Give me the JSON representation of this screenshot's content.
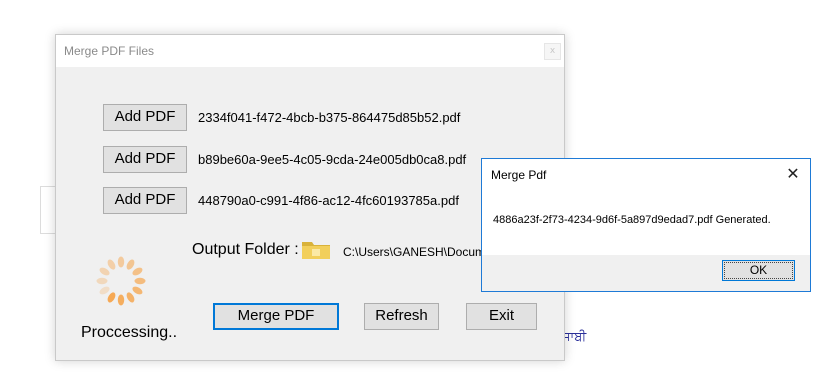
{
  "main_window": {
    "title": "Merge PDF Files",
    "close_glyph": "x",
    "rows": [
      {
        "button_label": "Add PDF",
        "file_name": "2334f041-f472-4bcb-b375-864475d85b52.pdf"
      },
      {
        "button_label": "Add PDF",
        "file_name": "b89be60a-9ee5-4c05-9cda-24e005db0ca8.pdf"
      },
      {
        "button_label": "Add PDF",
        "file_name": "448790a0-c991-4f86-ac12-4fc60193785a.pdf"
      }
    ],
    "output_folder_label": "Output Folder :",
    "output_folder_path": "C:\\Users\\GANESH\\Documents",
    "folder_icon": "folder-icon",
    "spinner_icon": "loading-spinner-icon",
    "status_text": "Proccessing..",
    "buttons": {
      "merge": "Merge PDF",
      "refresh": "Refresh",
      "exit": "Exit"
    }
  },
  "dialog": {
    "title": "Merge Pdf",
    "close_glyph": "✕",
    "message": "4886a23f-2f73-4234-9d6f-5a897d9edad7.pdf Generated.",
    "ok_label": "OK"
  },
  "background": {
    "text": "ਜਾਬੀ"
  },
  "colors": {
    "accent": "#0078d7",
    "window_bg": "#f0f0f0",
    "button_bg": "#e1e1e1",
    "spinner": "#f5a44a"
  }
}
